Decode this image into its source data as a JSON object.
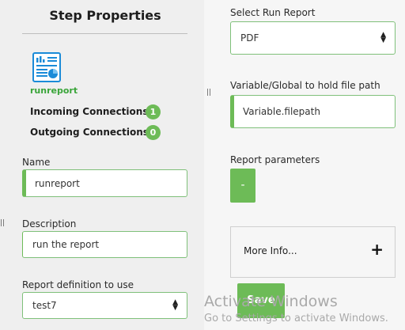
{
  "panel": {
    "title": "Step Properties",
    "step_name": "runreport",
    "incoming_label": "Incoming Connections:",
    "incoming_count": "1",
    "outgoing_label": "Outgoing Connections:",
    "outgoing_count": "0"
  },
  "fields": {
    "name_label": "Name",
    "name_value": "runreport",
    "description_label": "Description",
    "description_value": "run the report",
    "report_def_label": "Report definition to use",
    "report_def_value": "test7",
    "run_report_label": "Select Run Report",
    "run_report_value": "PDF",
    "variable_label": "Variable/Global to hold file path",
    "variable_value": "Variable.filepath",
    "params_label": "Report parameters",
    "params_button": "-"
  },
  "more_info": {
    "label": "More Info...",
    "toggle": "+"
  },
  "save_label": "Save",
  "handle_glyph": "||",
  "watermark": {
    "line1": "Activate Windows",
    "line2": "Go to Settings to activate Windows."
  },
  "icons": {
    "step": "report-icon",
    "select_arrows": "sort-arrows-icon",
    "expand": "plus-icon"
  },
  "colors": {
    "accent": "#6dbb57",
    "step_name": "#3aa53a",
    "border": "#7fc07a"
  }
}
